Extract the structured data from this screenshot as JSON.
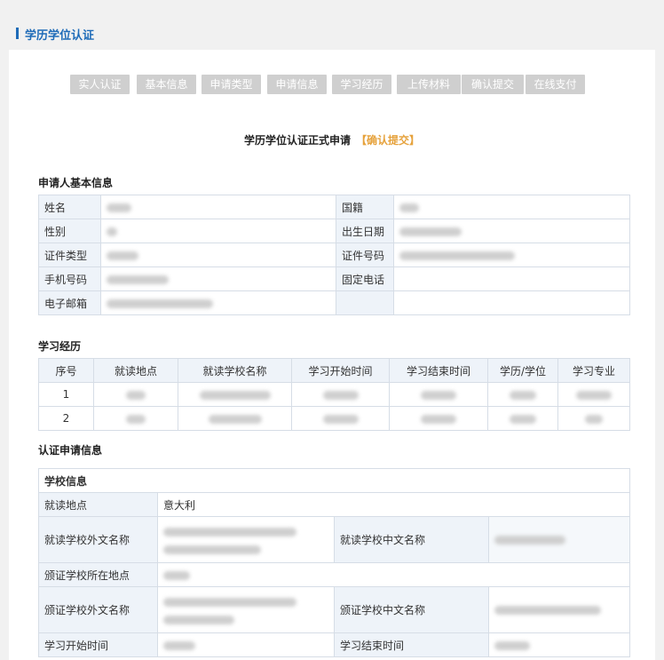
{
  "page": {
    "title": "学历学位认证"
  },
  "steps": [
    "实人认证",
    "基本信息",
    "申请类型",
    "申请信息",
    "学习经历",
    "上传材料",
    "确认提交",
    "在线支付"
  ],
  "form": {
    "title": "学历学位认证正式申请",
    "tag": "【确认提交】"
  },
  "applicant": {
    "section_title": "申请人基本信息",
    "labels": {
      "name": "姓名",
      "nationality": "国籍",
      "gender": "性别",
      "birth_date": "出生日期",
      "id_type": "证件类型",
      "id_number": "证件号码",
      "mobile": "手机号码",
      "phone": "固定电话",
      "email": "电子邮箱"
    }
  },
  "education": {
    "section_title": "学习经历",
    "headers": [
      "序号",
      "就读地点",
      "就读学校名称",
      "学习开始时间",
      "学习结束时间",
      "学历/学位",
      "学习专业"
    ],
    "rows": [
      {
        "index": "1"
      },
      {
        "index": "2"
      }
    ]
  },
  "cert": {
    "section_title": "认证申请信息",
    "school_info": "学校信息",
    "labels": {
      "study_location": "就读地点",
      "school_foreign_name": "就读学校外文名称",
      "school_cn_name": "就读学校中文名称",
      "issuer_location": "颁证学校所在地点",
      "issuer_foreign_name": "颁证学校外文名称",
      "issuer_cn_name": "颁证学校中文名称",
      "start_time": "学习开始时间",
      "end_time": "学习结束时间"
    },
    "values": {
      "study_location": "意大利"
    }
  },
  "colors": {
    "accent": "#1e6bb8",
    "tag": "#e6a23c",
    "step_bg": "#cfcfcf",
    "label_bg": "#eef3f9",
    "border": "#d6dde6"
  }
}
